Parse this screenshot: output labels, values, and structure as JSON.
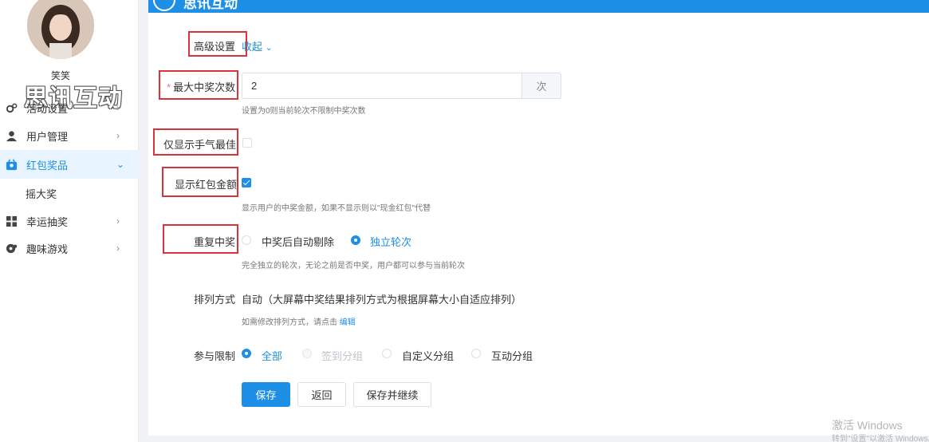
{
  "user": {
    "name": "笑笑"
  },
  "watermark": "思讯互动",
  "topbar": {
    "brand": "思讯互动",
    "right_item_1": "",
    "right_item_2": ""
  },
  "sidebar": {
    "items": [
      {
        "label": "活动设置",
        "icon": "gear-icon"
      },
      {
        "label": "用户管理",
        "icon": "user-icon"
      },
      {
        "label": "红包奖品",
        "icon": "gift-icon",
        "active": true
      },
      {
        "label": "幸运抽奖",
        "icon": "grid-icon"
      },
      {
        "label": "趣味游戏",
        "icon": "gamepad-icon"
      }
    ],
    "sub_items": [
      {
        "label": "摇大奖"
      }
    ]
  },
  "form": {
    "advanced": {
      "label": "高级设置",
      "toggle": "收起"
    },
    "max_wins": {
      "label": "最大中奖次数",
      "value": "2",
      "unit": "次",
      "hint": "设置为0则当前轮次不限制中奖次数"
    },
    "best_luck_only": {
      "label": "仅显示手气最佳",
      "checked": false
    },
    "show_amount": {
      "label": "显示红包金额",
      "checked": true,
      "hint": "显示用户的中奖金额，如果不显示则以\"现金红包\"代替"
    },
    "repeat_win": {
      "label": "重复中奖",
      "options": [
        "中奖后自动剔除",
        "独立轮次"
      ],
      "selected": "独立轮次",
      "hint": "完全独立的轮次，无论之前是否中奖，用户都可以参与当前轮次"
    },
    "arrangement": {
      "label": "排列方式",
      "value": "自动（大屏幕中奖结果排列方式为根据屏幕大小自适应排列）",
      "hint_prefix": "如需修改排列方式，请点击",
      "hint_link": "编辑"
    },
    "participation": {
      "label": "参与限制",
      "options": [
        "全部",
        "签到分组",
        "自定义分组",
        "互动分组"
      ],
      "selected": "全部",
      "disabled": [
        "签到分组"
      ]
    }
  },
  "buttons": {
    "save": "保存",
    "back": "返回",
    "save_continue": "保存并继续"
  },
  "windows_watermark": {
    "line1": "激活 Windows",
    "line2": "转到\"设置\"以激活 Windows。"
  },
  "colors": {
    "accent": "#1e8fe6",
    "highlight_box": "#d9343b",
    "required": "#f56c6c"
  }
}
